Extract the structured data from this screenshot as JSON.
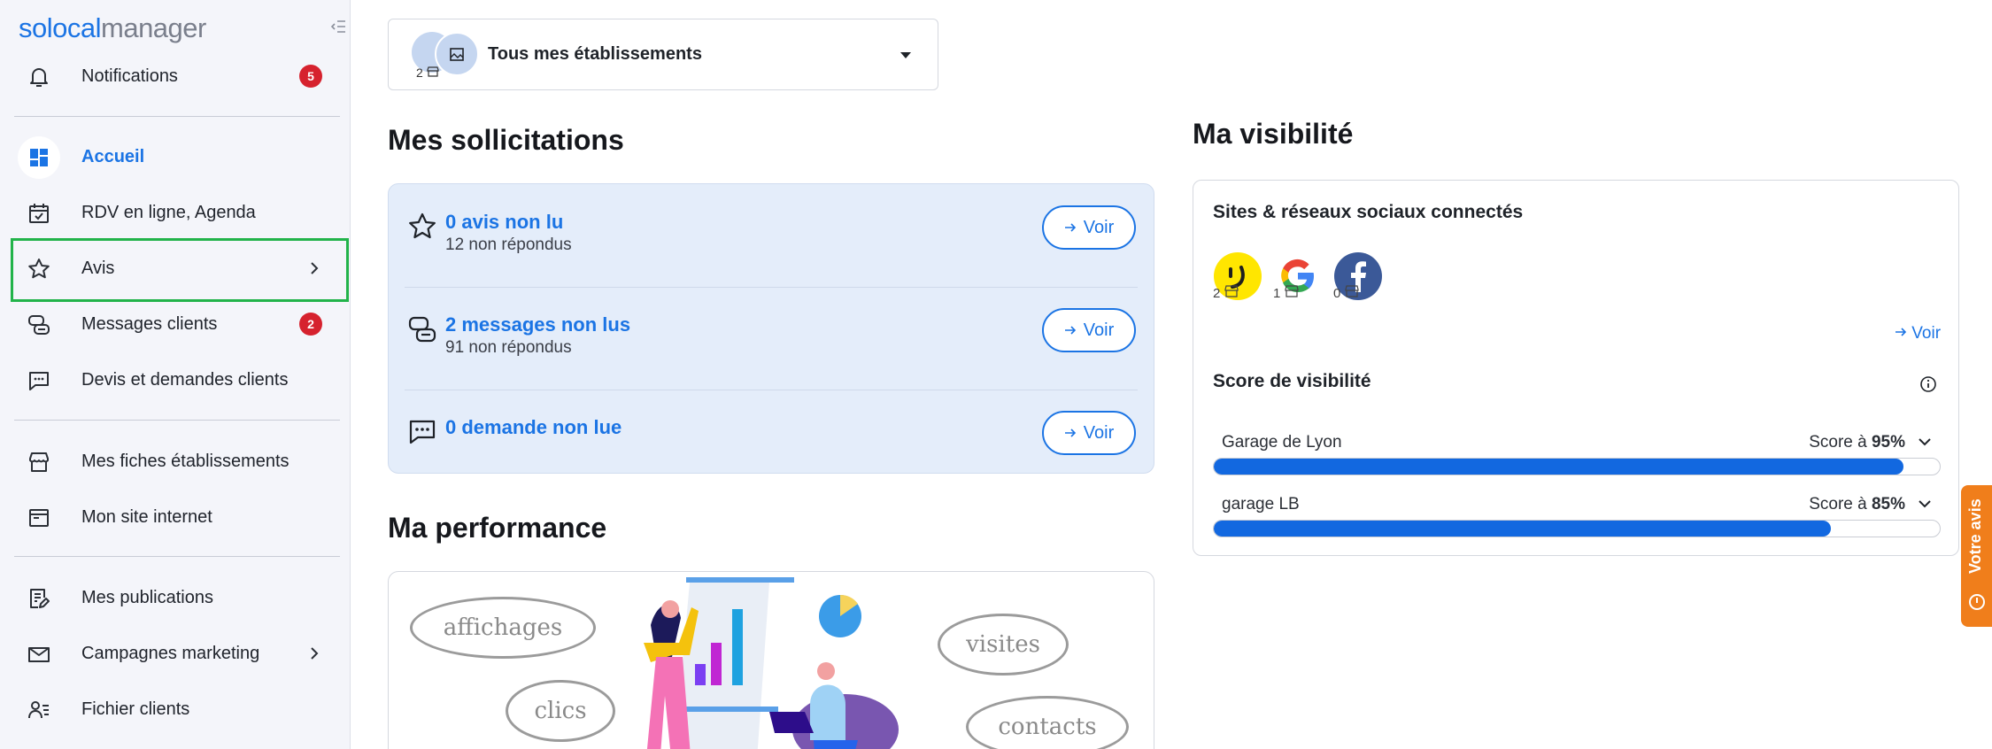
{
  "app": {
    "logo_part1": "solocal",
    "logo_part2": "manager"
  },
  "sidebar": {
    "notifications": {
      "label": "Notifications",
      "badge": "5"
    },
    "items": [
      {
        "label": "Accueil"
      },
      {
        "label": "RDV en ligne, Agenda"
      },
      {
        "label": "Avis"
      },
      {
        "label": "Messages clients",
        "badge": "2"
      },
      {
        "label": "Devis et demandes clients"
      },
      {
        "label": "Mes fiches établissements"
      },
      {
        "label": "Mon site internet"
      },
      {
        "label": "Mes publications"
      },
      {
        "label": "Campagnes marketing"
      },
      {
        "label": "Fichier clients"
      }
    ]
  },
  "selector": {
    "count": "2",
    "title": "Tous mes établissements"
  },
  "sollicitations": {
    "title": "Mes sollicitations",
    "rows": [
      {
        "primary": "0 avis non lu",
        "secondary": "12 non répondus",
        "button": "Voir"
      },
      {
        "primary": "2 messages non lus",
        "secondary": "91 non répondus",
        "button": "Voir"
      },
      {
        "primary": "0 demande non lue",
        "secondary": "",
        "button": "Voir"
      }
    ]
  },
  "performance": {
    "title": "Ma performance",
    "bubbles": [
      "affichages",
      "clics",
      "visites",
      "contacts"
    ]
  },
  "visibilite": {
    "title": "Ma visibilité",
    "networks_title": "Sites & réseaux sociaux connectés",
    "networks": [
      {
        "icon": "pagesjaunes-icon",
        "count": "2"
      },
      {
        "icon": "google-icon",
        "count": "1"
      },
      {
        "icon": "facebook-icon",
        "count": "0"
      }
    ],
    "voir_link": "Voir",
    "score_title": "Score de visibilité",
    "scores": [
      {
        "name": "Garage de Lyon",
        "prefix": "Score à",
        "value": "95%",
        "fraction": 0.95
      },
      {
        "name": "garage LB",
        "prefix": "Score à",
        "value": "85%",
        "fraction": 0.85
      }
    ]
  },
  "feedback_tab": "Votre avis",
  "colors": {
    "brand_blue": "#1b74e4",
    "badge_red": "#d6222e",
    "highlight_green": "#22b34a",
    "feedback_orange": "#f07e1b"
  }
}
